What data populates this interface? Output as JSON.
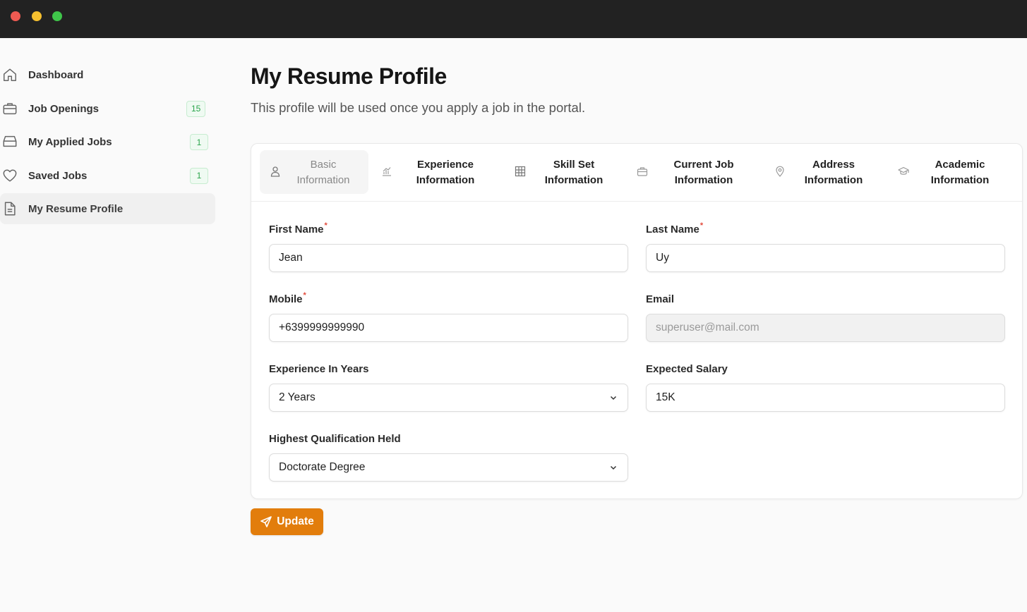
{
  "sidebar": {
    "items": [
      {
        "label": "Dashboard",
        "icon": "home-icon"
      },
      {
        "label": "Job Openings",
        "icon": "briefcase-icon",
        "badge": "15"
      },
      {
        "label": "My Applied Jobs",
        "icon": "inbox-icon",
        "badge": "1"
      },
      {
        "label": "Saved Jobs",
        "icon": "heart-icon",
        "badge": "1"
      },
      {
        "label": "My Resume Profile",
        "icon": "document-icon",
        "active": true
      }
    ]
  },
  "page": {
    "title": "My Resume Profile",
    "subtitle": "This profile will be used once you apply a job in the portal."
  },
  "tabs": [
    {
      "label": "Basic\nInformation",
      "icon": "user-icon",
      "active": true
    },
    {
      "label": "Experience\nInformation",
      "icon": "chart-icon"
    },
    {
      "label": "Skill Set\nInformation",
      "icon": "grid-icon"
    },
    {
      "label": "Current Job\nInformation",
      "icon": "briefcase-icon"
    },
    {
      "label": "Address\nInformation",
      "icon": "map-pin-icon"
    },
    {
      "label": "Academic\nInformation",
      "icon": "graduation-cap-icon"
    }
  ],
  "form": {
    "first_name": {
      "label": "First Name",
      "required": "*",
      "value": "Jean"
    },
    "last_name": {
      "label": "Last Name",
      "required": "*",
      "value": "Uy"
    },
    "mobile": {
      "label": "Mobile",
      "required": "*",
      "value": "+6399999999990"
    },
    "email": {
      "label": "Email",
      "value": "superuser@mail.com"
    },
    "experience": {
      "label": "Experience In Years",
      "value": "2 Years"
    },
    "salary": {
      "label": "Expected Salary",
      "value": "15K"
    },
    "qualification": {
      "label": "Highest Qualification Held",
      "value": "Doctorate Degree"
    }
  },
  "actions": {
    "update_label": "Update"
  },
  "colors": {
    "accent": "#e27d0c",
    "badge_text": "#29a44a",
    "badge_bg": "#effaf2",
    "required": "#e24a3b",
    "titlebar": "#222222"
  }
}
